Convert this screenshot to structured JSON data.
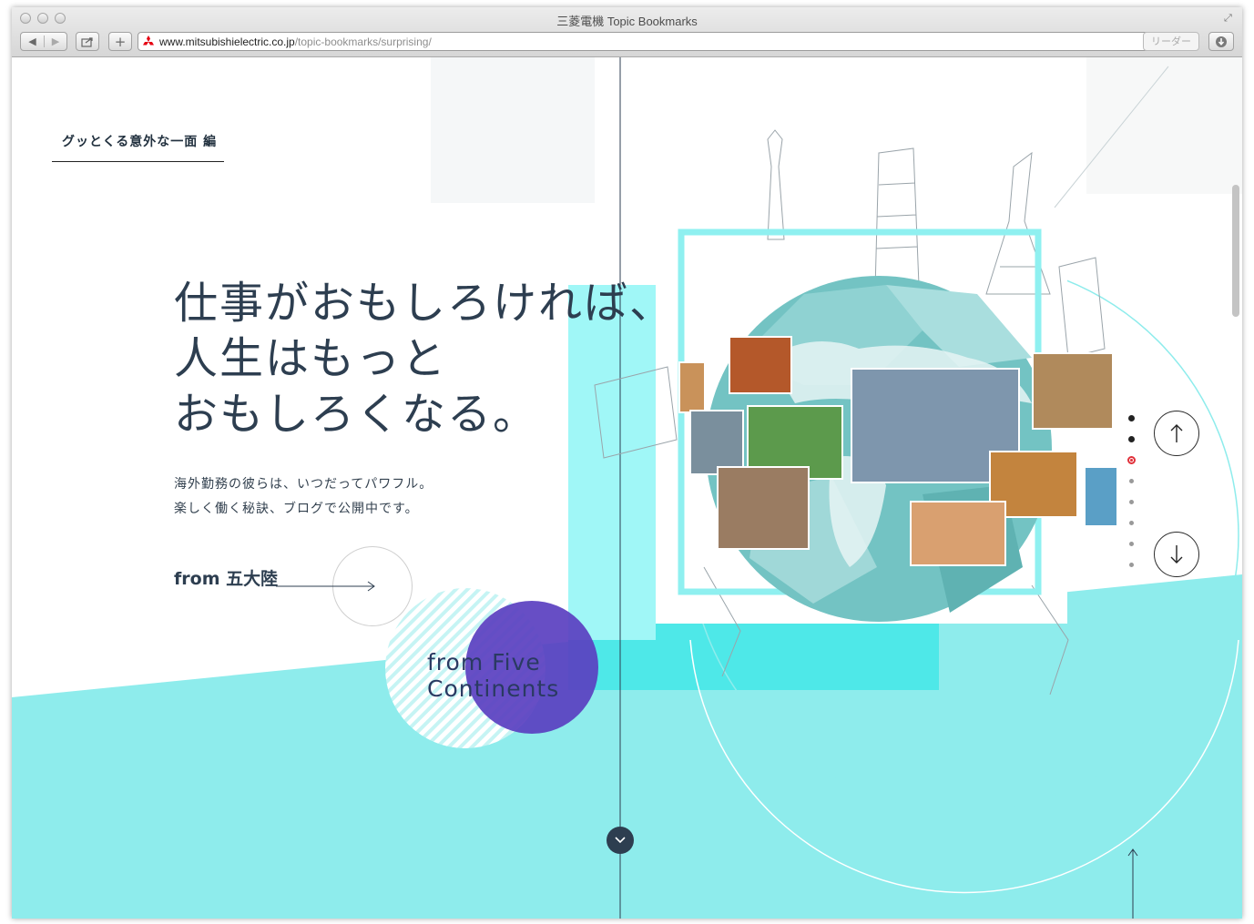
{
  "window": {
    "title": "三菱電機 Topic Bookmarks"
  },
  "toolbar": {
    "back_icon": "back-arrow-icon",
    "forward_icon": "forward-arrow-icon",
    "share_icon": "share-icon",
    "new_tab_label": "+",
    "url_host": "www.mitsubishielectric.co.jp",
    "url_path": "/topic-bookmarks/surprising/",
    "reader_label": "リーダー",
    "reload_icon": "reload-icon",
    "download_icon": "download-icon"
  },
  "page": {
    "breadcrumb": "グッとくる意外な一面 編",
    "headline": [
      "仕事がおもしろければ、",
      "人生はもっと",
      "おもしろくなる。"
    ],
    "lead": [
      "海外勤務の彼らは、いつだってパワフル。",
      "楽しく働く秘訣、ブログで公開中です。"
    ],
    "from_label": "from 五大陸",
    "badge": [
      "from Five",
      "Continents"
    ],
    "pager": {
      "total": 8,
      "current": 3,
      "up_icon": "arrow-up-icon",
      "down_icon": "arrow-down-icon"
    },
    "scroll_icon": "chevron-down-icon"
  },
  "colors": {
    "accent_cyan": "#8eecec",
    "bright_cyan": "#4ee8e8",
    "purple": "#5a3fc0",
    "navy": "#2d3e50",
    "active_dot": "#e0303a"
  }
}
